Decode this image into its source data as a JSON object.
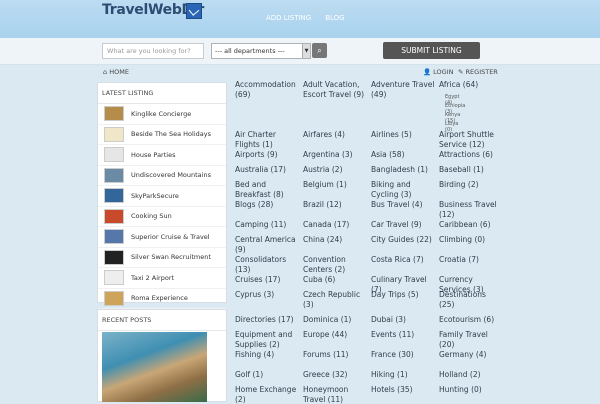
{
  "header": {
    "logo": "TravelWebDir",
    "nav": [
      "ADD LISTING",
      "BLOG"
    ]
  },
  "search": {
    "placeholder": "What are you looking for?",
    "department": "--- all departments ---",
    "submit_label": "SUBMIT LISTING"
  },
  "breadcrumb": {
    "home": "HOME",
    "login": "LOGIN",
    "register": "REGISTER"
  },
  "sidebar": {
    "latest_title": "LATEST LISTING",
    "listings": [
      "Kinglike Concierge",
      "Beside The Sea Holidays",
      "House Parties",
      "Undiscovered Mountains",
      "SkyParkSecure",
      "Cooking Sun",
      "Superior Cruise & Travel",
      "Silver Swan Recruitment",
      "Taxi 2 Airport",
      "Roma Experience"
    ],
    "recent_title": "RECENT POSTS"
  },
  "categories": [
    "Accommodation (69)",
    "Adult Vacation, Escort Travel (9)",
    "Adventure Travel (49)",
    "Africa (64)",
    "Air Charter Flights (1)",
    "Airfares (4)",
    "Airlines (5)",
    "Airport Shuttle Service (12)",
    "Airports (9)",
    "Argentina (3)",
    "Asia (58)",
    "Attractions (6)",
    "Australia (17)",
    "Austria (2)",
    "Bangladesh (1)",
    "Baseball (1)",
    "Bed and Breakfast (8)",
    "Belgium (1)",
    "Biking and Cycling (3)",
    "Birding (2)",
    "Blogs (28)",
    "Brazil (12)",
    "Bus Travel (4)",
    "Business Travel (12)",
    "Camping (11)",
    "Canada (17)",
    "Car Travel (9)",
    "Caribbean (6)",
    "Central America (9)",
    "China (24)",
    "City Guides (22)",
    "Climbing (0)",
    "Consolidators (13)",
    "Convention Centers (2)",
    "Costa Rica (7)",
    "Croatia (7)",
    "Cruises (17)",
    "Cuba (6)",
    "Culinary Travel (7)",
    "Currency Services (3)",
    "Cyprus (3)",
    "Czech Republic (3)",
    "Day Trips (5)",
    "Destinations (25)",
    "Directories (17)",
    "Dominica (1)",
    "Dubai (3)",
    "Ecotourism (6)",
    "Equipment and Supplies (2)",
    "Europe (44)",
    "Events (11)",
    "Family Travel (20)",
    "Fishing (4)",
    "Forums (11)",
    "France (30)",
    "Germany (4)",
    "Golf (1)",
    "Greece (32)",
    "Hiking (1)",
    "Holland (2)",
    "Home Exchange (2)",
    "Honeymoon Travel (11)",
    "Hotels (35)",
    "Hunting (0)"
  ],
  "africa_sub": [
    "Egypt (4)",
    "Ethiopia (3)",
    "Kenya (15)",
    "Libya (0)"
  ]
}
